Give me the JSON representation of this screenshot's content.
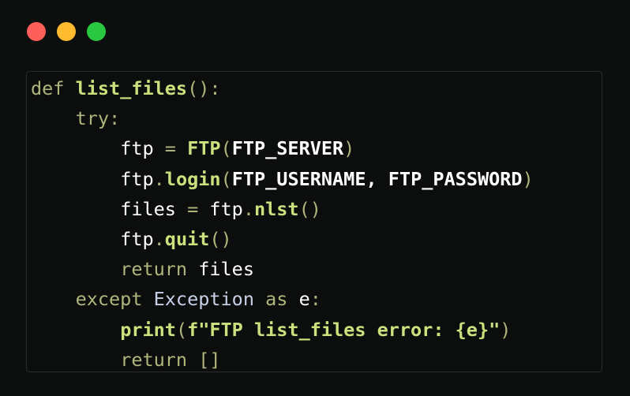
{
  "window": {
    "controls": {
      "close_color": "#fe5f58",
      "minimize_color": "#febc2e",
      "maximize_color": "#29c840"
    }
  },
  "code": {
    "language": "python",
    "lines": [
      [
        {
          "t": "def ",
          "c": "kw"
        },
        {
          "t": "list_files",
          "c": "fn"
        },
        {
          "t": "():",
          "c": "punc"
        }
      ],
      [
        {
          "t": "    ",
          "c": "var"
        },
        {
          "t": "try:",
          "c": "kw"
        }
      ],
      [
        {
          "t": "        ",
          "c": "var"
        },
        {
          "t": "ftp ",
          "c": "var"
        },
        {
          "t": "= ",
          "c": "punc"
        },
        {
          "t": "FTP",
          "c": "fn"
        },
        {
          "t": "(",
          "c": "punc"
        },
        {
          "t": "FTP_SERVER",
          "c": "var-b"
        },
        {
          "t": ")",
          "c": "punc"
        }
      ],
      [
        {
          "t": "        ",
          "c": "var"
        },
        {
          "t": "ftp",
          "c": "var"
        },
        {
          "t": ".",
          "c": "punc"
        },
        {
          "t": "login",
          "c": "fn"
        },
        {
          "t": "(",
          "c": "punc"
        },
        {
          "t": "FTP_USERNAME, FTP_PASSWORD",
          "c": "var-b"
        },
        {
          "t": ")",
          "c": "punc"
        }
      ],
      [
        {
          "t": "        ",
          "c": "var"
        },
        {
          "t": "files ",
          "c": "var"
        },
        {
          "t": "= ",
          "c": "punc"
        },
        {
          "t": "ftp",
          "c": "var"
        },
        {
          "t": ".",
          "c": "punc"
        },
        {
          "t": "nlst",
          "c": "fn"
        },
        {
          "t": "()",
          "c": "punc"
        }
      ],
      [
        {
          "t": "        ",
          "c": "var"
        },
        {
          "t": "ftp",
          "c": "var"
        },
        {
          "t": ".",
          "c": "punc"
        },
        {
          "t": "quit",
          "c": "fn"
        },
        {
          "t": "()",
          "c": "punc"
        }
      ],
      [
        {
          "t": "        ",
          "c": "var"
        },
        {
          "t": "return ",
          "c": "kw"
        },
        {
          "t": "files",
          "c": "var"
        }
      ],
      [
        {
          "t": "    ",
          "c": "var"
        },
        {
          "t": "except ",
          "c": "kw"
        },
        {
          "t": "Exception",
          "c": "class"
        },
        {
          "t": " as ",
          "c": "kw"
        },
        {
          "t": "e",
          "c": "var"
        },
        {
          "t": ":",
          "c": "punc"
        }
      ],
      [
        {
          "t": "        ",
          "c": "var"
        },
        {
          "t": "print",
          "c": "fn"
        },
        {
          "t": "(",
          "c": "punc"
        },
        {
          "t": "f\"FTP list_files error: {e}\"",
          "c": "str"
        },
        {
          "t": ")",
          "c": "punc"
        }
      ],
      [
        {
          "t": "        ",
          "c": "var"
        },
        {
          "t": "return []",
          "c": "kw"
        }
      ]
    ]
  }
}
